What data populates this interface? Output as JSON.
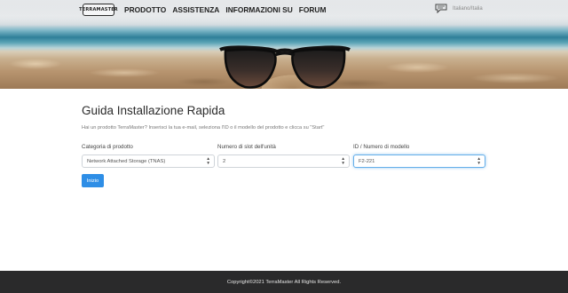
{
  "header": {
    "logo_text": "TERRAMASTER",
    "nav": [
      "PRODOTTO",
      "ASSISTENZA",
      "INFORMAZIONI SU",
      "FORUM"
    ],
    "language": "Italiano/Italia",
    "language_icon": "chat-bubble-icon"
  },
  "main": {
    "title": "Guida Installazione Rapida",
    "subtitle": "Hai un prodotto TerraMaster? Inserisci la tua e-mail, seleziona l'ID o il modello del prodotto e clicca su \"Start\"",
    "fields": [
      {
        "label": "Categoria di prodotto",
        "value": "Network Attached Storage (TNAS)"
      },
      {
        "label": "Numero di slot dell'unità",
        "value": "2"
      },
      {
        "label": "ID / Numero di modello",
        "value": "F2-221"
      }
    ],
    "start_label": "Inizio"
  },
  "footer": {
    "copyright": "Copyright©2021 TerraMaster All Rights Reserved."
  }
}
